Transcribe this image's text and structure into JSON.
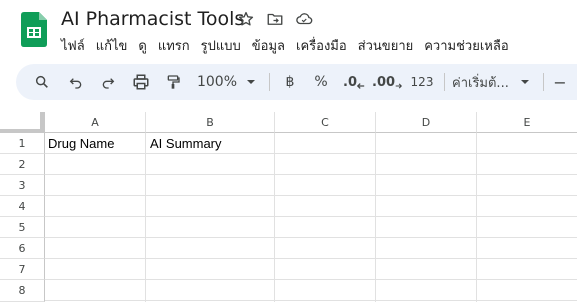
{
  "app": {
    "title": "AI Pharmacist Tools",
    "menu": [
      "ไฟล์",
      "แก้ไข",
      "ดู",
      "แทรก",
      "รูปแบบ",
      "ข้อมูล",
      "เครื่องมือ",
      "ส่วนขยาย",
      "ความช่วยเหลือ"
    ]
  },
  "toolbar": {
    "zoom": "100%",
    "currency": "฿",
    "percent": "%",
    "decrease_decimal": ".0",
    "increase_decimal": ".00",
    "number_format": "123",
    "font": "ค่าเริ่มต้...",
    "minus": "−"
  },
  "grid": {
    "columns": [
      "A",
      "B",
      "C",
      "D",
      "E"
    ],
    "rows": [
      "1",
      "2",
      "3",
      "4",
      "5",
      "6",
      "7",
      "8"
    ],
    "cells": {
      "A1": "Drug Name",
      "B1": "AI Summary"
    }
  },
  "colors": {
    "brand_green": "#0f9d58",
    "toolbar_bg": "#edf2fa",
    "grid_line": "#e1e1e1"
  }
}
